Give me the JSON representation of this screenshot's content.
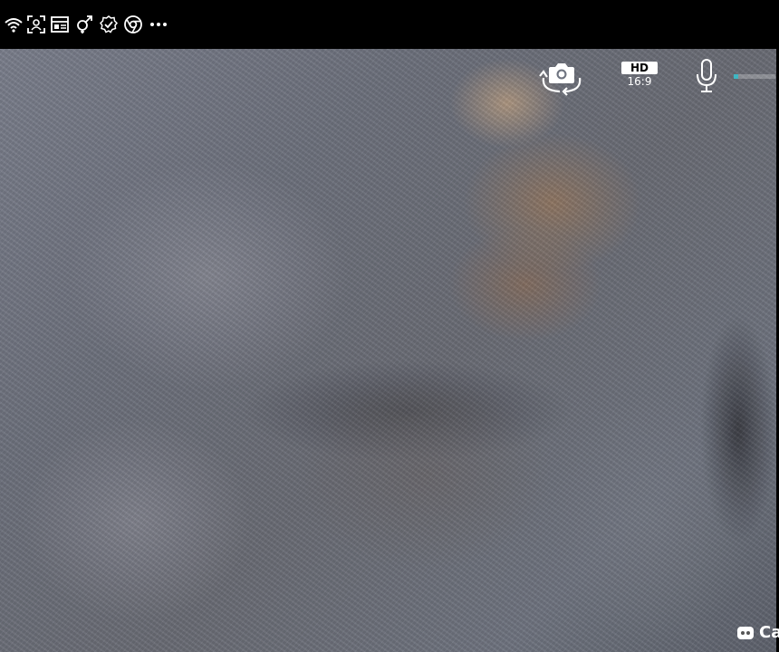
{
  "status_bar": {
    "icons": [
      "wifi-icon",
      "face-scan-icon",
      "calendar-app-icon",
      "gender-icon",
      "check-shield-icon",
      "chrome-icon",
      "more-icon"
    ]
  },
  "camera": {
    "switch_camera_icon": "switch-camera-icon",
    "resolution": "HD",
    "aspect_ratio": "16:9",
    "mic_icon": "microphone-icon",
    "mic_level": 0.1,
    "accent_color": "#3fb6c2",
    "bottom_label": "Ca"
  }
}
